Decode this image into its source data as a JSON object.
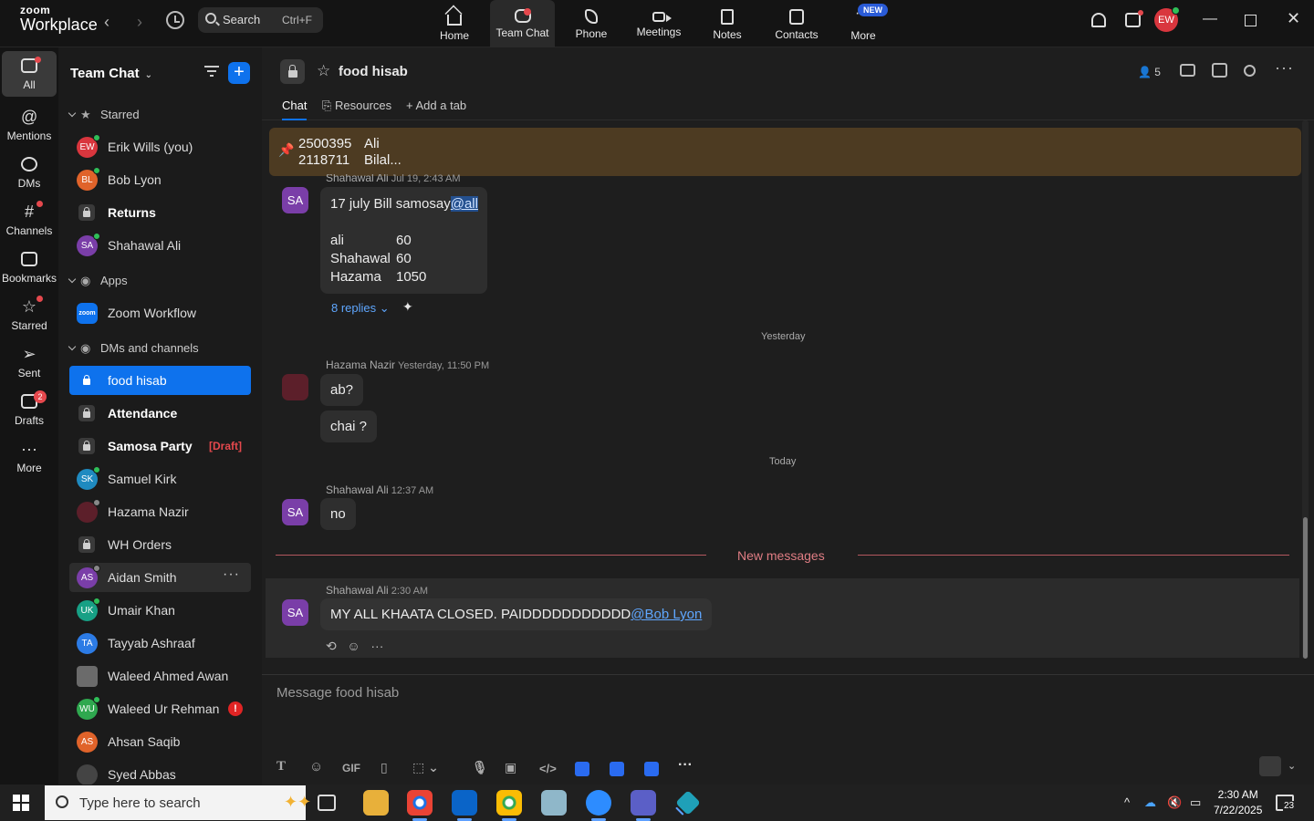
{
  "app": {
    "logo_line1": "zoom",
    "logo_line2": "Workplace",
    "search_label": "Search",
    "search_shortcut": "Ctrl+F",
    "user_initials": "EW",
    "accent": "#0e72ed",
    "nav_tabs": [
      {
        "label": "Home",
        "icon": "home-icon"
      },
      {
        "label": "Team Chat",
        "icon": "chat-icon"
      },
      {
        "label": "Phone",
        "icon": "phone-icon"
      },
      {
        "label": "Meetings",
        "icon": "video-icon"
      },
      {
        "label": "Notes",
        "icon": "notes-icon"
      },
      {
        "label": "Contacts",
        "icon": "contacts-icon"
      },
      {
        "label": "More",
        "icon": "more-icon"
      }
    ],
    "new_badge": "NEW"
  },
  "rail": [
    {
      "label": "All"
    },
    {
      "label": "Mentions"
    },
    {
      "label": "DMs"
    },
    {
      "label": "Channels"
    },
    {
      "label": "Bookmarks"
    },
    {
      "label": "Starred"
    },
    {
      "label": "Sent"
    },
    {
      "label": "Drafts",
      "badge": "2"
    },
    {
      "label": "More"
    }
  ],
  "sidebar": {
    "title": "Team Chat",
    "starred_header": "Starred",
    "apps_header": "Apps",
    "dms_header": "DMs and channels",
    "starred": [
      {
        "initials": "EW",
        "name": "Erik Wills (you)",
        "color": "#d9363e"
      },
      {
        "initials": "BL",
        "name": "Bob Lyon",
        "color": "#e0632a"
      },
      {
        "name": "Returns"
      },
      {
        "initials": "SA",
        "name": "Shahawal Ali",
        "color": "#7a3ea8"
      }
    ],
    "apps": [
      {
        "logo": "zoom",
        "name": "Zoom Workflow"
      }
    ],
    "dms": [
      {
        "name": "food hisab"
      },
      {
        "name": "Attendance"
      },
      {
        "name": "Samosa Party",
        "draft": "[Draft]"
      },
      {
        "initials": "SK",
        "name": "Samuel Kirk",
        "color": "#1f8ac0"
      },
      {
        "initials": "",
        "name": "Hazama Nazir",
        "color": "#5c1f2a"
      },
      {
        "name": "WH Orders"
      },
      {
        "initials": "AS",
        "name": "Aidan Smith",
        "color": "#7a3ea8"
      },
      {
        "initials": "UK",
        "name": "Umair Khan",
        "color": "#17a085"
      },
      {
        "initials": "TA",
        "name": "Tayyab Ashraaf",
        "color": "#2c7be5"
      },
      {
        "initials": "",
        "name": "Waleed Ahmed Awan",
        "color": "#6b6b6b"
      },
      {
        "initials": "WU",
        "name": "Waleed Ur Rehman",
        "color": "#2fa84f",
        "alert": "!"
      },
      {
        "initials": "AS",
        "name": "Ahsan Saqib",
        "color": "#e0632a"
      },
      {
        "initials": "",
        "name": "Syed Abbas",
        "color": "#444"
      }
    ]
  },
  "channel": {
    "name": "food hisab",
    "members": "5",
    "tabs": [
      "Chat",
      "Resources",
      "Add a tab"
    ],
    "pinned": {
      "col1": [
        "2500395",
        "2118711"
      ],
      "col2": [
        "Ali",
        "Bilal..."
      ]
    },
    "messages": [
      {
        "initials": "SA",
        "author": "Shahawal Ali",
        "time": "Jul 19, 2:43 AM",
        "text": "17 july Bill samosay",
        "mention": "@all",
        "lines": [
          [
            "ali",
            "60"
          ],
          [
            "Shahawal",
            "60"
          ],
          [
            "Hazama",
            "1050"
          ]
        ],
        "replies": "8 replies"
      },
      {
        "day": "Yesterday"
      },
      {
        "author": "Hazama Nazir",
        "time": "Yesterday, 11:50 PM",
        "bubbles": [
          "ab?",
          "chai ?"
        ]
      },
      {
        "day": "Today"
      },
      {
        "initials": "SA",
        "author": "Shahawal Ali",
        "time": "12:37 AM",
        "text": "no"
      },
      {
        "new_messages": "New messages"
      },
      {
        "initials": "SA",
        "author": "Shahawal Ali",
        "time": "2:30 AM",
        "text": "MY ALL KHAATA CLOSED. PAIDDDDDDDDDDD",
        "mention": "@Bob Lyon"
      }
    ],
    "composer_placeholder": "Message food hisab"
  },
  "taskbar": {
    "search_placeholder": "Type here to search",
    "time": "2:30 AM",
    "date": "7/22/2025",
    "notifications": "23"
  }
}
